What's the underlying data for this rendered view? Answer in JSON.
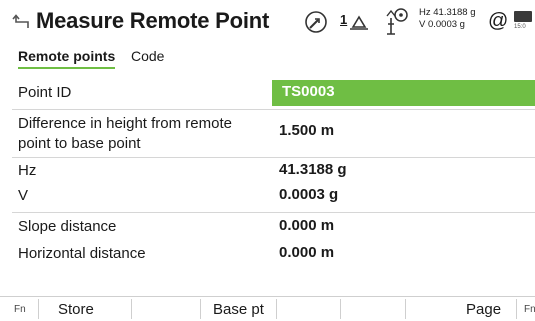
{
  "header": {
    "title": "Measure Remote Point",
    "prism_constant": "1",
    "hz_readout": "Hz 41.3188 g",
    "v_readout": "V  0.0003 g",
    "at_symbol": "@",
    "battery_text": "15:0",
    "icons": [
      "back-arrow-icon",
      "globe-icon",
      "prism-icon",
      "target-icon",
      "battery-icon"
    ]
  },
  "tabs": {
    "active": "Remote points",
    "second": "Code"
  },
  "fields": {
    "point_id": {
      "label": "Point ID",
      "value": "TS0003"
    },
    "height_diff": {
      "label_line1": "Difference in height from remote",
      "label_line2": "point to base point",
      "value": "1.500 m"
    },
    "hz": {
      "label": "Hz",
      "value": "41.3188 g"
    },
    "v": {
      "label": "V",
      "value": "0.0003 g"
    },
    "slope": {
      "label": "Slope distance",
      "value": "0.000 m"
    },
    "horizontal": {
      "label": "Horizontal distance",
      "value": "0.000 m"
    }
  },
  "softkeys": {
    "fn_left": "Fn",
    "store": "Store",
    "base_pt": "Base pt",
    "page": "Page",
    "fn_right": "Fn"
  },
  "colors": {
    "accent": "#6fbe44",
    "divider": "#d6d6d6",
    "text": "#1a1a1a"
  }
}
